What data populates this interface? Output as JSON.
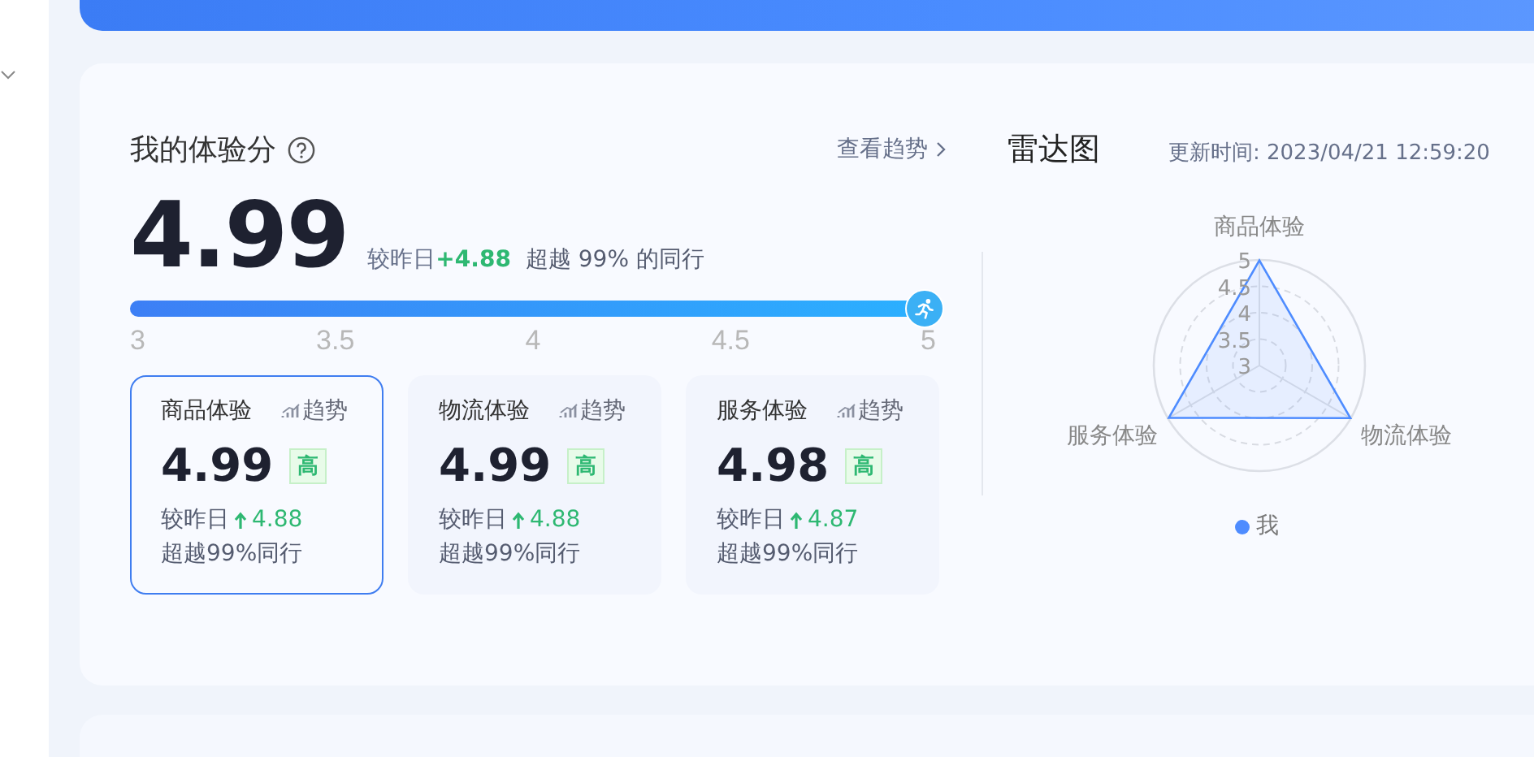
{
  "experience": {
    "title": "我的体验分",
    "trend_link": "查看趋势",
    "score": "4.99",
    "compare_label": "较昨日",
    "compare_value": "+4.88",
    "rank_text": "超越 99% 的同行",
    "progress": {
      "level": 0.995,
      "ticks": [
        "3",
        "3.5",
        "4",
        "4.5",
        "5"
      ]
    },
    "cards": [
      {
        "title": "商品体验",
        "trend": "趋势",
        "score": "4.99",
        "badge": "高",
        "compare_label": "较昨日",
        "delta": "4.88",
        "rank": "超越99%同行",
        "selected": true
      },
      {
        "title": "物流体验",
        "trend": "趋势",
        "score": "4.99",
        "badge": "高",
        "compare_label": "较昨日",
        "delta": "4.88",
        "rank": "超越99%同行",
        "selected": false
      },
      {
        "title": "服务体验",
        "trend": "趋势",
        "score": "4.98",
        "badge": "高",
        "compare_label": "较昨日",
        "delta": "4.87",
        "rank": "超越99%同行",
        "selected": false
      }
    ]
  },
  "radar": {
    "title": "雷达图",
    "updated": "更新时间: 2023/04/21 12:59:20",
    "axes": [
      "商品体验",
      "物流体验",
      "服务体验"
    ],
    "ticks": [
      "5",
      "4.5",
      "4",
      "3.5",
      "3"
    ],
    "legend": [
      {
        "label": "我",
        "color": "#4e8cff"
      }
    ]
  }
}
